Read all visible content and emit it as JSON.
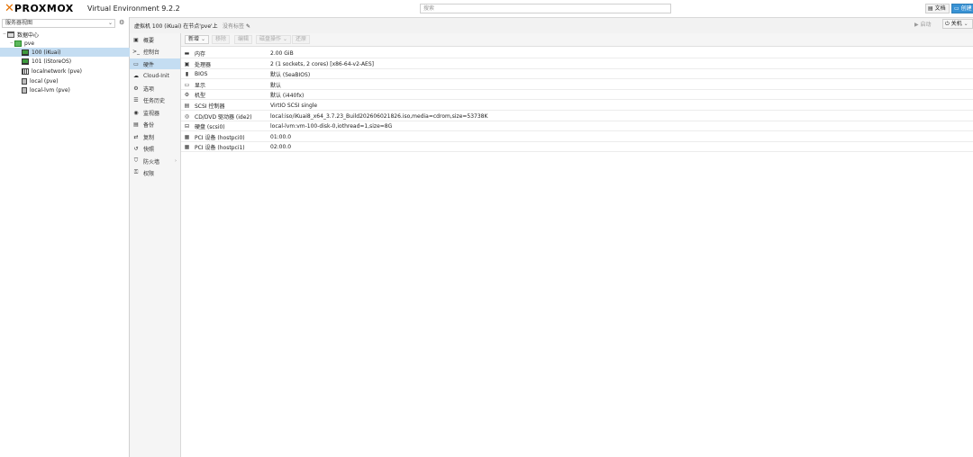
{
  "topbar": {
    "logo_text": "PROXMOX",
    "version": "Virtual Environment 9.2.2",
    "search_placeholder": "搜索",
    "docs_label": "文档",
    "create_vm_label": "创建"
  },
  "tree": {
    "view_label": "服务器视图",
    "items": [
      {
        "label": "数据中心",
        "icon": "datacenter-icon"
      },
      {
        "label": "pve",
        "icon": "node-icon"
      },
      {
        "label": "100 (iKuai)",
        "icon": "vm-icon"
      },
      {
        "label": "101 (iStoreOS)",
        "icon": "vm-icon"
      },
      {
        "label": "localnetwork (pve)",
        "icon": "network-icon"
      },
      {
        "label": "local (pve)",
        "icon": "storage-icon"
      },
      {
        "label": "local-lvm (pve)",
        "icon": "storage-icon"
      }
    ]
  },
  "header": {
    "breadcrumb": "虚拟机 100 (iKuai) 在节点'pve'上",
    "tags_label": "没有标签",
    "start_label": "启动",
    "shutdown_label": "关机"
  },
  "nav": {
    "items": [
      {
        "label": "概要",
        "icon": "summary-icon"
      },
      {
        "label": "控制台",
        "icon": "console-icon"
      },
      {
        "label": "硬件",
        "icon": "hardware-icon"
      },
      {
        "label": "Cloud-Init",
        "icon": "cloud-icon"
      },
      {
        "label": "选项",
        "icon": "options-icon"
      },
      {
        "label": "任务历史",
        "icon": "task-history-icon"
      },
      {
        "label": "监视器",
        "icon": "monitor-icon"
      },
      {
        "label": "备份",
        "icon": "backup-icon"
      },
      {
        "label": "复制",
        "icon": "replication-icon"
      },
      {
        "label": "快照",
        "icon": "snapshot-icon"
      },
      {
        "label": "防火墙",
        "icon": "firewall-icon"
      },
      {
        "label": "权限",
        "icon": "permissions-icon"
      }
    ]
  },
  "toolbar": {
    "add_label": "新增",
    "remove_label": "移除",
    "edit_label": "编辑",
    "disk_action_label": "磁盘操作",
    "revert_label": "还原"
  },
  "hardware": {
    "rows": [
      {
        "name": "内存",
        "value": "2.00 GiB",
        "icon": "memory-icon"
      },
      {
        "name": "处理器",
        "value": "2 (1 sockets, 2 cores) [x86-64-v2-AES]",
        "icon": "cpu-icon"
      },
      {
        "name": "BIOS",
        "value": "默认 (SeaBIOS)",
        "icon": "bios-icon"
      },
      {
        "name": "显示",
        "value": "默认",
        "icon": "display-icon"
      },
      {
        "name": "机型",
        "value": "默认 (i440fx)",
        "icon": "machine-icon"
      },
      {
        "name": "SCSI 控制器",
        "value": "VirtIO SCSI single",
        "icon": "scsi-icon"
      },
      {
        "name": "CD/DVD 驱动器 (ide2)",
        "value": "local:iso/iKuai8_x64_3.7.23_Build202606021826.iso,media=cdrom,size=53738K",
        "icon": "cdrom-icon"
      },
      {
        "name": "硬盘 (scsi0)",
        "value": "local-lvm:vm-100-disk-0,iothread=1,size=8G",
        "icon": "harddisk-icon"
      },
      {
        "name": "PCI 设备 (hostpci0)",
        "value": "01:00.0",
        "icon": "pci-icon"
      },
      {
        "name": "PCI 设备 (hostpci1)",
        "value": "02:00.0",
        "icon": "pci-icon"
      }
    ]
  },
  "colors": {
    "accent": "#3892d4",
    "logo_orange": "#e57000",
    "selection": "#c4ddf2"
  }
}
